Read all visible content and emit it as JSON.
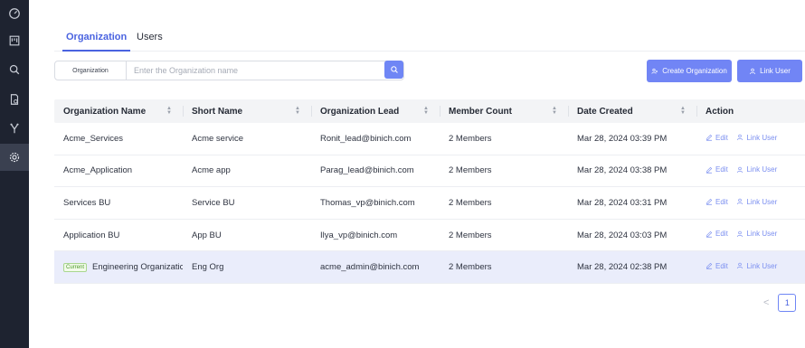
{
  "sidebar": {
    "items": [
      {
        "icon": "speedometer-icon"
      },
      {
        "icon": "board-icon"
      },
      {
        "icon": "search-icon"
      },
      {
        "icon": "document-settings-icon"
      },
      {
        "icon": "branch-icon"
      },
      {
        "icon": "gear-icon",
        "active": true
      }
    ]
  },
  "tabs": [
    {
      "label": "Organization",
      "active": true
    },
    {
      "label": "Users",
      "active": false
    }
  ],
  "search": {
    "scope_label": "Organization",
    "placeholder": "Enter the Organization name",
    "value": ""
  },
  "buttons": {
    "create_org": "Create Organization",
    "link_user": "Link User"
  },
  "table": {
    "headers": [
      "Organization Name",
      "Short Name",
      "Organization Lead",
      "Member Count",
      "Date Created",
      "Action"
    ],
    "rows": [
      {
        "name": "Acme_Services",
        "short": "Acme service",
        "lead": "Ronit_lead@binich.com",
        "members": "2 Members",
        "date": "Mar 28, 2024 03:39 PM",
        "current": false
      },
      {
        "name": "Acme_Application",
        "short": "Acme app",
        "lead": "Parag_lead@binich.com",
        "members": "2 Members",
        "date": "Mar 28, 2024 03:38 PM",
        "current": false
      },
      {
        "name": "Services BU",
        "short": "Service BU",
        "lead": "Thomas_vp@binich.com",
        "members": "2 Members",
        "date": "Mar 28, 2024 03:31 PM",
        "current": false
      },
      {
        "name": "Application BU",
        "short": "App BU",
        "lead": "Ilya_vp@binich.com",
        "members": "2 Members",
        "date": "Mar 28, 2024 03:03 PM",
        "current": false
      },
      {
        "name": "Engineering Organizatic",
        "short": "Eng Org",
        "lead": "acme_admin@binich.com",
        "members": "2 Members",
        "date": "Mar 28, 2024 02:38 PM",
        "current": true
      }
    ],
    "current_badge": "Current",
    "edit_label": "Edit",
    "link_user_label": "Link User"
  },
  "pagination": {
    "prev": "<",
    "current_page": "1"
  },
  "colors": {
    "accent": "#4a63e0",
    "button": "#7185f5",
    "sidebar": "#1e2330",
    "current_row": "#eaedfb"
  }
}
